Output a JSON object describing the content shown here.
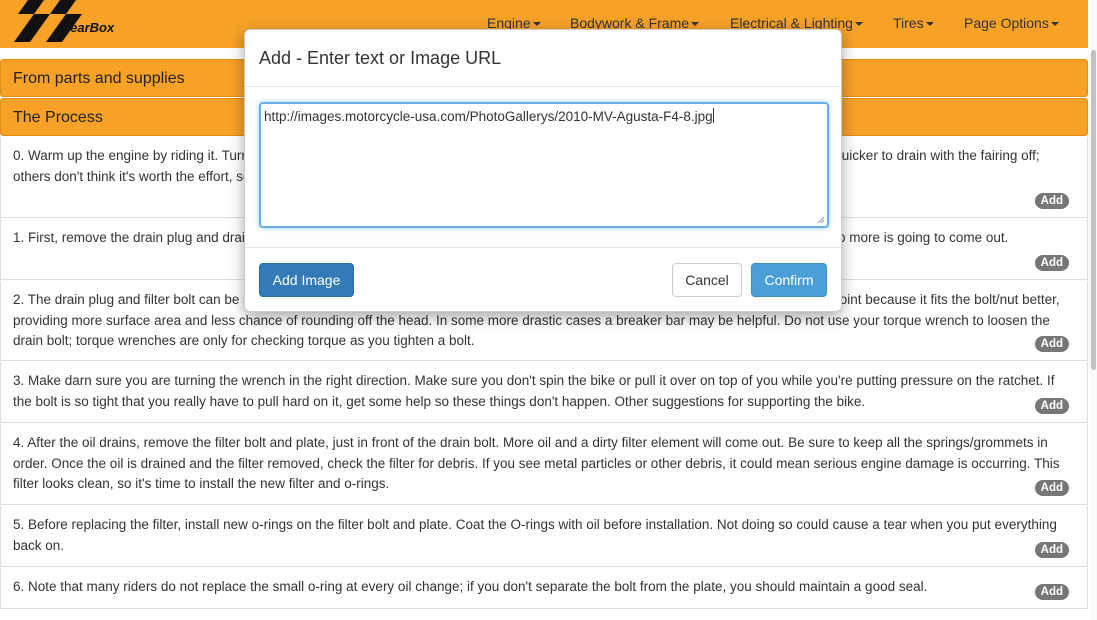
{
  "navbar": {
    "brand": "GearBox",
    "menu": [
      {
        "label": "Engine"
      },
      {
        "label": "Bodywork & Frame"
      },
      {
        "label": "Electrical & Lighting"
      },
      {
        "label": "Tires"
      },
      {
        "label": "Page Options"
      }
    ]
  },
  "sections": {
    "parts": "From parts and supplies",
    "process": "The Process"
  },
  "steps": [
    {
      "text": "0. Warm up the engine by riding it. Turning the bike off and removing the lower fairing is optional. Some people prefer to do it because it's quicker to drain with the fairing off; others don't think it's worth the effort, so it's up to you; it's held on by 7 bolts.",
      "add": "Add"
    },
    {
      "text": "1. First, remove the drain plug and drain bolt. Removing the oil filler cap will help the oil drain faster. Let the oil drain until it's obvious that no more is going to come out.",
      "add": "Add"
    },
    {
      "text": "2. The drain plug and filter bolt can be stubborn to remove. Use a long-handled ratchet, shown below. A 6-point socket is superior to a 12-point because it fits the bolt/nut better, providing more surface area and less chance of rounding off the head. In some more drastic cases a breaker bar may be helpful. Do not use your torque wrench to loosen the drain bolt; torque wrenches are only for checking torque as you tighten a bolt.",
      "add": "Add"
    },
    {
      "text": "3. Make darn sure you are turning the wrench in the right direction. Make sure you don't spin the bike or pull it over on top of you while you're putting pressure on the ratchet. If the bolt is so tight that you really have to pull hard on it, get some help so these things don't happen. Other suggestions for supporting the bike.",
      "add": "Add"
    },
    {
      "text": "4. After the oil drains, remove the filter bolt and plate, just in front of the drain bolt. More oil and a dirty filter element will come out. Be sure to keep all the springs/grommets in order. Once the oil is drained and the filter removed, check the filter for debris. If you see metal particles or other debris, it could mean serious engine damage is occurring. This filter looks clean, so it's time to install the new filter and o-rings.",
      "add": "Add"
    },
    {
      "text": "5. Before replacing the filter, install new o-rings on the filter bolt and plate. Coat the O-rings with oil before installation. Not doing so could cause a tear when you put everything back on.",
      "add": "Add"
    },
    {
      "text": "6. Note that many riders do not replace the small o-ring at every oil change; if you don't separate the bolt from the plate, you should maintain a good seal.",
      "add": "Add"
    }
  ],
  "modal": {
    "title": "Add - Enter text or Image URL",
    "input_value": "http://images.motorcycle-usa.com/PhotoGallerys/2010-MV-Agusta-F4-8.jpg",
    "add_image_label": "Add Image",
    "cancel_label": "Cancel",
    "confirm_label": "Confirm"
  },
  "colors": {
    "navbar": "#f7a127",
    "primary_button": "#337ab7",
    "confirm_button": "#4a9fd8",
    "badge": "#777777"
  }
}
